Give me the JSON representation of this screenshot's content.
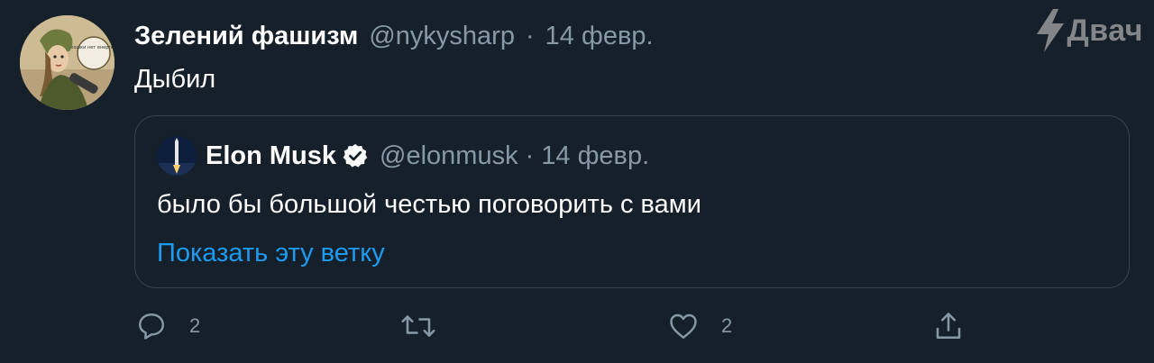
{
  "watermark": {
    "text": "Двач"
  },
  "tweet": {
    "display_name": "Зелений фашизм",
    "handle": "@nykysharp",
    "separator": "·",
    "date": "14 февр.",
    "text": "Дыбил",
    "avatar_badge": "кошки нет енергий"
  },
  "quote": {
    "display_name": "Elon Musk",
    "handle": "@elonmusk",
    "separator": "·",
    "date": "14 февр.",
    "text": "было бы большой честью поговорить с вами",
    "show_thread": "Показать эту ветку"
  },
  "actions": {
    "reply_count": "2",
    "like_count": "2"
  },
  "colors": {
    "background": "#15202b",
    "secondary_text": "#8899a6",
    "link": "#1d9bf0",
    "border": "#38444d"
  }
}
